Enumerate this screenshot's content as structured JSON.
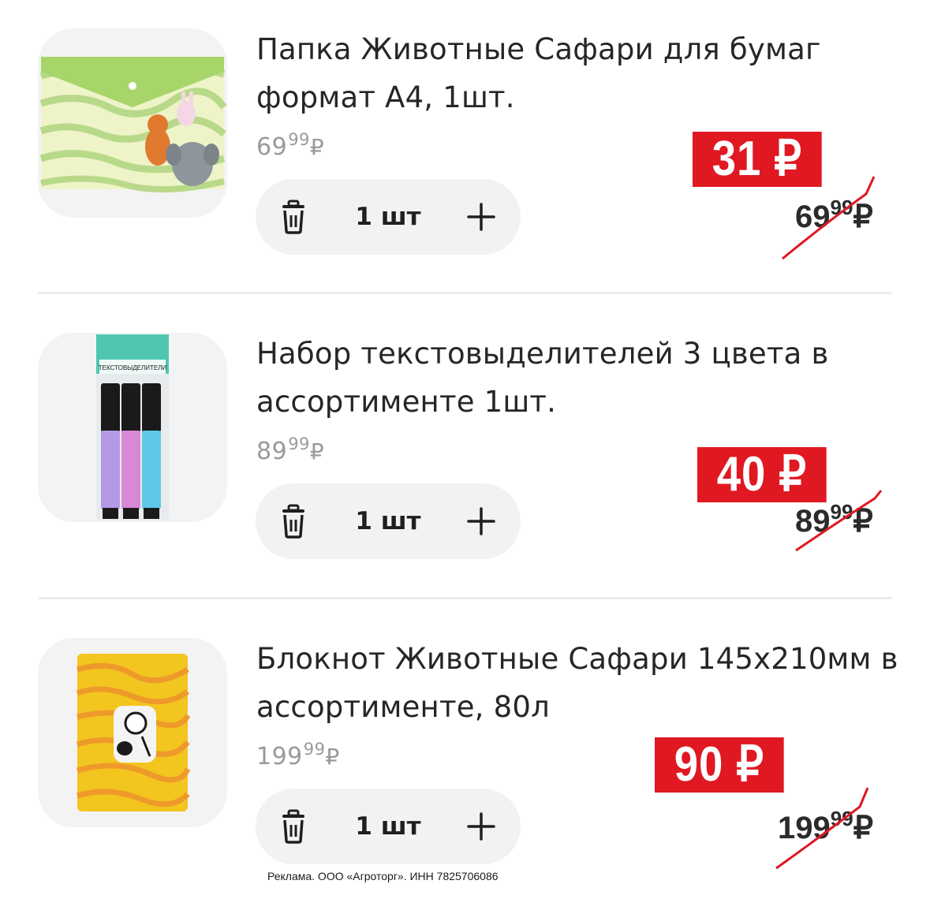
{
  "items": [
    {
      "title_line1": "Папка Животные Сафари для бумаг",
      "title_line2": "формат А4, 1шт.",
      "unit_price": {
        "main": "69",
        "cents": "99",
        "currency": "₽"
      },
      "quantity": "1 шт",
      "promo_price": "31 ₽",
      "old_price": {
        "main": "69",
        "cents": "99",
        "currency": "₽"
      },
      "image_icon": "safari-folder-image"
    },
    {
      "title_line1": "Набор текстовыделителей 3 цвета в",
      "title_line2": "ассортименте 1шт.",
      "unit_price": {
        "main": "89",
        "cents": "99",
        "currency": "₽"
      },
      "quantity": "1 шт",
      "promo_price": "40 ₽",
      "old_price": {
        "main": "89",
        "cents": "99",
        "currency": "₽"
      },
      "image_icon": "highlighter-set-image",
      "package_label": "ТЕКСТОВЫДЕЛИТЕЛИ"
    },
    {
      "title_line1": "Блокнот Животные Сафари 145х210мм в",
      "title_line2": "ассортименте, 80л",
      "unit_price": {
        "main": "199",
        "cents": "99",
        "currency": "₽"
      },
      "quantity": "1 шт",
      "promo_price": "90 ₽",
      "old_price": {
        "main": "199",
        "cents": "99",
        "currency": "₽"
      },
      "image_icon": "zebra-notebook-image"
    }
  ],
  "footer": {
    "ad_text": "Реклама. ООО «Агроторг». ИНН 7825706086"
  },
  "colors": {
    "promo_red": "#e01822",
    "strike_red": "#e01822",
    "stepper_bg": "#f2f2f2",
    "muted_text": "#9a9a9a"
  }
}
